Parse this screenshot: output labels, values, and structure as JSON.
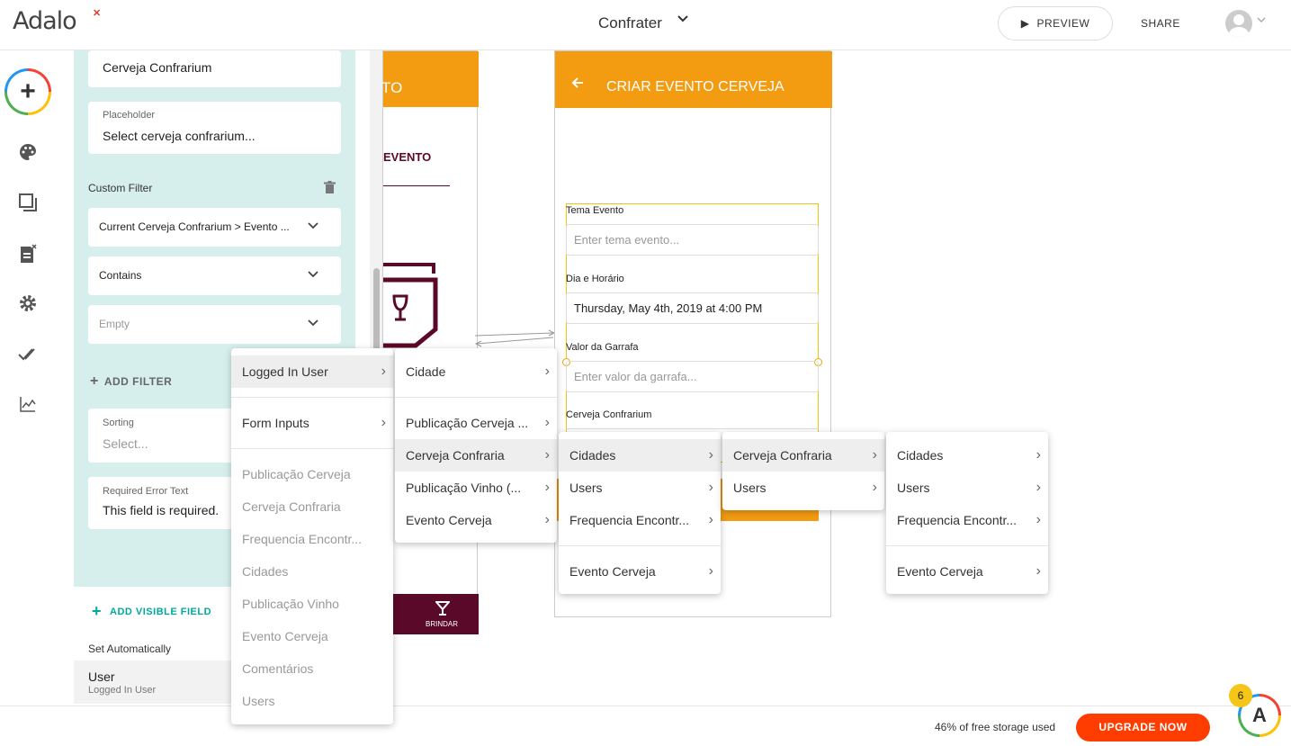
{
  "topbar": {
    "logo": "Adalo",
    "app_name": "Confrater",
    "app_chevron": "chevron-down-icon",
    "preview_label": "PREVIEW",
    "share_label": "SHARE"
  },
  "rail": {
    "icons": [
      "add-icon",
      "palette-icon",
      "screens-icon",
      "database-icon",
      "settings-icon",
      "publish-icon",
      "analytics-icon"
    ]
  },
  "panel": {
    "label_value": "Cerveja Confrarium",
    "placeholder_label": "Placeholder",
    "placeholder_value": "Select cerveja confrarium...",
    "custom_filter_label": "Custom Filter",
    "filter_field": "Current Cerveja Confrarium > Evento ...",
    "filter_op": "Contains",
    "filter_value": "Empty",
    "add_filter": "ADD FILTER",
    "sorting_label": "Sorting",
    "sorting_value": "Select...",
    "error_label": "Required Error Text",
    "error_value": "This field is required.",
    "add_visible_field": "ADD VISIBLE FIELD",
    "set_auto_label": "Set Automatically",
    "user_title": "User",
    "user_sub": "Logged In User"
  },
  "canvas": {
    "screen1_title": "TO",
    "screen1_tab": "EVENTO",
    "screen1_nav": "BRINDAR",
    "screen2_title": "CRIAR EVENTO CERVEJA",
    "fields": {
      "tema_label": "Tema Evento",
      "tema_ph": "Enter tema evento...",
      "dia_label": "Dia e Horário",
      "dia_value": "Thursday, May 4th, 2019 at 4:00 PM",
      "valor_label": "Valor da Garrafa",
      "valor_ph": "Enter valor da garrafa...",
      "cerveja_label": "Cerveja Confrarium"
    }
  },
  "menus": {
    "m1": {
      "logged_in_user": "Logged In User",
      "form_inputs": "Form Inputs",
      "items": [
        "Publicação Cerveja",
        "Cerveja Confraria",
        "Frequencia Encontr...",
        "Cidades",
        "Publicação Vinho",
        "Evento Cerveja",
        "Comentários",
        "Users"
      ]
    },
    "m2": [
      "Cidade",
      "Publicação Cerveja ...",
      "Cerveja Confraria",
      "Publicação Vinho (...",
      "Evento Cerveja"
    ],
    "m3": [
      "Cidades",
      "Users",
      "Frequencia Encontr...",
      "Evento Cerveja"
    ],
    "m4": [
      "Cerveja Confraria",
      "Users"
    ],
    "m5": [
      "Cidades",
      "Users",
      "Frequencia Encontr...",
      "Evento Cerveja"
    ]
  },
  "footer": {
    "storage": "46% of free storage used",
    "upgrade": "UPGRADE NOW",
    "notif_count": "6"
  },
  "colors": {
    "accent_orange": "#f39c12",
    "upgrade_red": "#ff3d00",
    "panel_teal": "#d6efed",
    "maroon": "#5a0a28"
  }
}
